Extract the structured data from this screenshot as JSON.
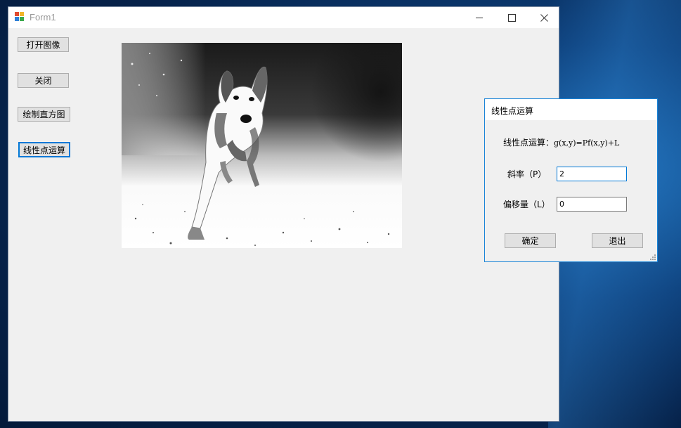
{
  "main_window": {
    "title": "Form1",
    "buttons": {
      "open_image": "打开图像",
      "close": "关闭",
      "draw_histogram": "绘制直方图",
      "linear_point_op": "线性点运算"
    }
  },
  "dialog": {
    "title": "线性点运算",
    "formula_label": "线性点运算：",
    "formula": "g(x,y)=Pf(x,y)+L",
    "slope_label": "斜率（P）",
    "slope_value": "2",
    "offset_label": "偏移量（L）",
    "offset_value": "0",
    "ok_button": "确定",
    "exit_button": "退出"
  },
  "colors": {
    "focus_accent": "#0078d7",
    "window_bg": "#f0f0f0"
  },
  "icons": [
    "app-icon",
    "minimize-icon",
    "maximize-icon",
    "close-icon",
    "resize-grip-icon"
  ]
}
